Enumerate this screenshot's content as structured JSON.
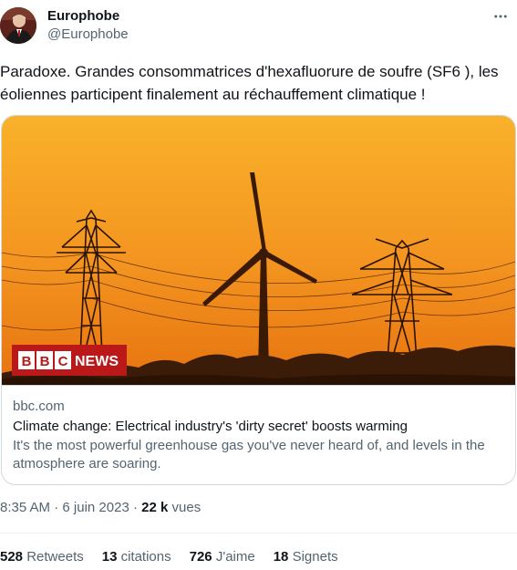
{
  "author": {
    "name": "Europhobe",
    "handle": "@Europhobe"
  },
  "tweet": {
    "text": "Paradoxe. Grandes consommatrices d'hexafluorure de soufre (SF6 ), les éoliennes participent finalement au réchauffement climatique !"
  },
  "card": {
    "image_badge_text": "BBC NEWS",
    "domain": "bbc.com",
    "title": "Climate change: Electrical industry's 'dirty secret' boosts warming",
    "description": "It's the most powerful greenhouse gas you've never heard of, and levels in the atmosphere are soaring."
  },
  "meta": {
    "time": "8:35 AM",
    "separator": "·",
    "date": "6 juin 2023",
    "views_count": "22 k",
    "views_label": "vues"
  },
  "stats": [
    {
      "count": "528",
      "label": "Retweets"
    },
    {
      "count": "13",
      "label": "citations"
    },
    {
      "count": "726",
      "label": "J'aime"
    },
    {
      "count": "18",
      "label": "Signets"
    }
  ],
  "colors": {
    "text_primary": "#0f1419",
    "text_secondary": "#536471",
    "border": "#cfd9de",
    "sky_top": "#f7b22c",
    "sky_bottom": "#e8740f",
    "bbc_red": "#bb1919"
  },
  "icons": {
    "more": "more-horizontal-icon"
  }
}
